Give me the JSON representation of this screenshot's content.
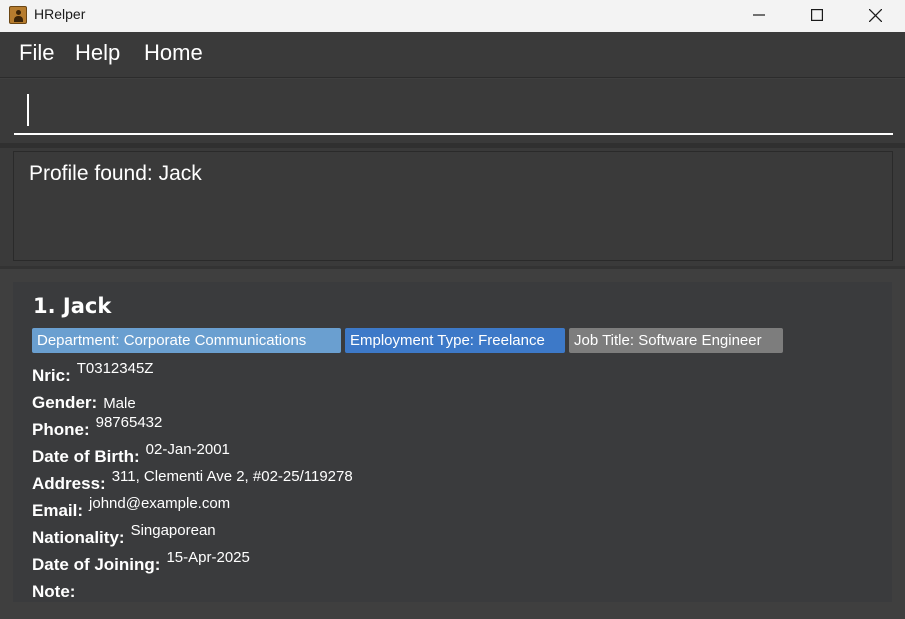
{
  "window": {
    "title": "HRelper"
  },
  "menu": {
    "file": "File",
    "help": "Help",
    "home": "Home"
  },
  "command": {
    "value": "",
    "placeholder": ""
  },
  "result": {
    "message": "Profile found: Jack"
  },
  "person": {
    "index_name": "1.  Jack",
    "tags": {
      "department": "Department: Corporate Communications",
      "employment": "Employment Type: Freelance",
      "job": "Job Title: Software Engineer"
    },
    "fields": {
      "nric": {
        "label": "Nric:",
        "value": "T0312345Z"
      },
      "gender": {
        "label": "Gender:",
        "value": "Male"
      },
      "phone": {
        "label": "Phone:",
        "value": "98765432"
      },
      "dob": {
        "label": "Date of Birth:",
        "value": "02-Jan-2001"
      },
      "address": {
        "label": "Address:",
        "value": "311, Clementi Ave 2, #02-25/119278"
      },
      "email": {
        "label": "Email:",
        "value": "johnd@example.com"
      },
      "nationality": {
        "label": "Nationality:",
        "value": "Singaporean"
      },
      "doj": {
        "label": "Date of Joining:",
        "value": "15-Apr-2025"
      },
      "note": {
        "label": "Note:",
        "value": ""
      }
    }
  },
  "colors": {
    "department_tag": "#6a9fd0",
    "employment_tag": "#3d79c8",
    "job_tag": "#7d7d7d"
  },
  "icons": {
    "app": "person-card-icon",
    "minimize": "minimize-icon",
    "maximize": "maximize-icon",
    "close": "close-icon"
  }
}
